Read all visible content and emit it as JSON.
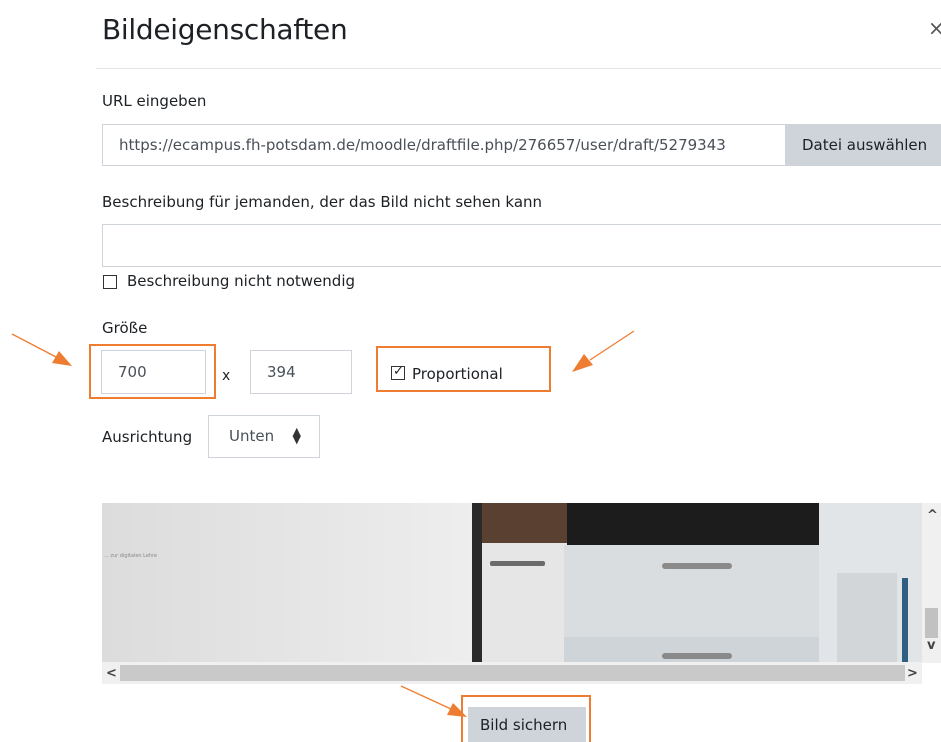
{
  "dialog": {
    "title": "Bildeigenschaften",
    "close_symbol": "×"
  },
  "url": {
    "label": "URL eingeben",
    "value": "https://ecampus.fh-potsdam.de/moodle/draftfile.php/276657/user/draft/5279343",
    "file_button": "Datei auswählen"
  },
  "description": {
    "label": "Beschreibung für jemanden, der das Bild nicht sehen kann",
    "value": "",
    "not_needed_label": "Beschreibung nicht notwendig",
    "not_needed_checked": false
  },
  "size": {
    "label": "Größe",
    "width": "700",
    "separator": "x",
    "height": "394",
    "proportional_label": "Proportional",
    "proportional_checked": true
  },
  "alignment": {
    "label": "Ausrichtung",
    "selected": "Unten"
  },
  "preview": {
    "caption_text": "... zur digitalen Lehre",
    "scroll_left": "<",
    "scroll_right": ">",
    "scroll_up": "^",
    "scroll_down": "v"
  },
  "footer": {
    "save_label": "Bild sichern"
  },
  "colors": {
    "accent_highlight": "#ee7d31",
    "button_bg": "#ced4da",
    "border": "#ced4da"
  }
}
